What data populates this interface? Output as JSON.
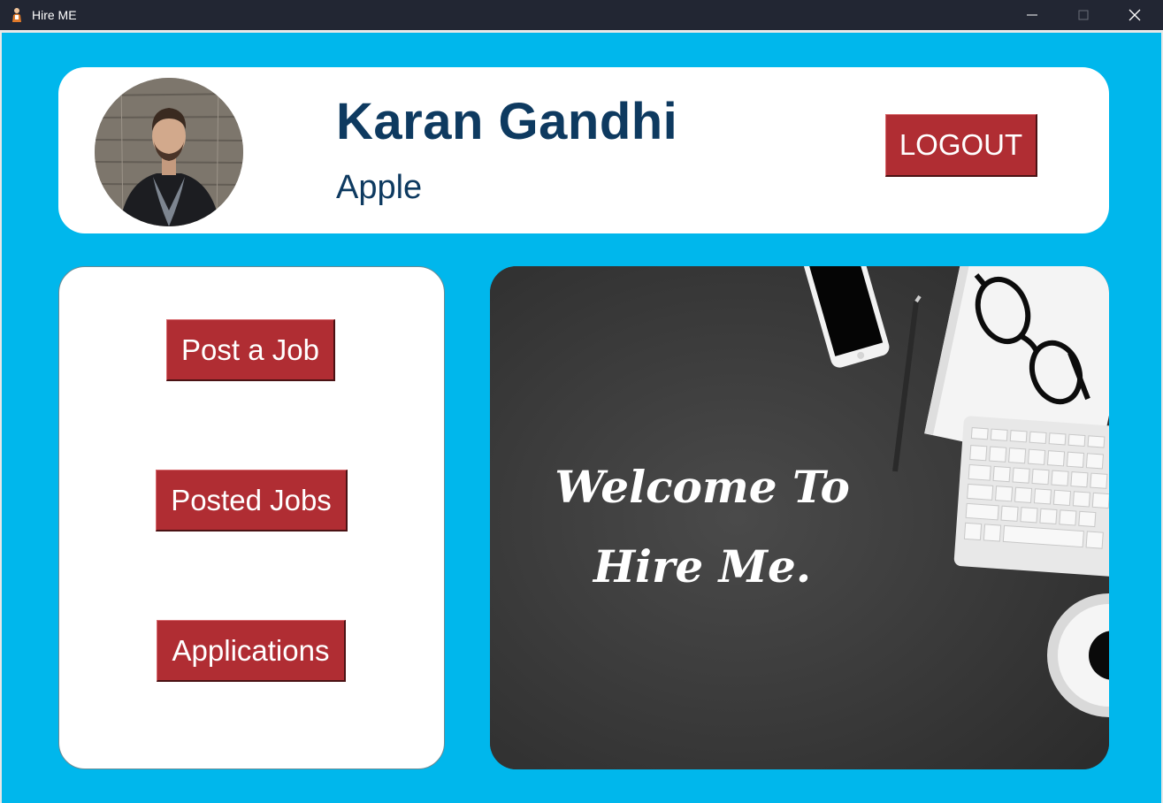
{
  "window": {
    "title": "Hire ME",
    "icon": "person-icon",
    "controls": [
      "minimize-icon",
      "maximize-icon",
      "close-icon"
    ]
  },
  "header": {
    "avatar": "profile-photo",
    "name": "Karan Gandhi",
    "company": "Apple",
    "logout_label": "LOGOUT"
  },
  "menu": {
    "post_job_label": "Post a Job",
    "posted_jobs_label": "Posted Jobs",
    "applications_label": "Applications"
  },
  "banner": {
    "line1": "Welcome To",
    "line2": "Hire Me."
  },
  "colors": {
    "background": "#00b7ec",
    "button": "#b02d33",
    "name_text": "#0e3a60",
    "titlebar": "#222633"
  }
}
